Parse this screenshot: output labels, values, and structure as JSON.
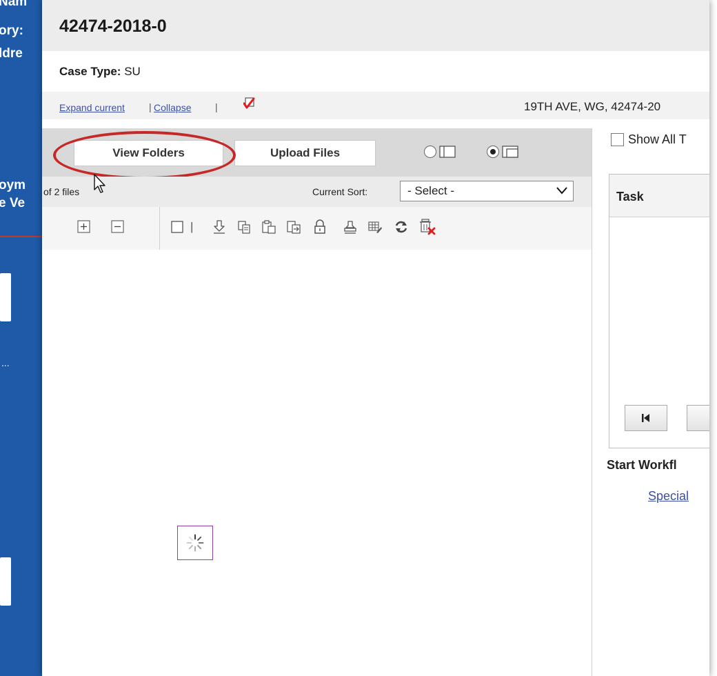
{
  "background": {
    "fragments": [
      "Nam",
      "ory:",
      "ldre",
      "oym",
      "e Ve",
      "..."
    ]
  },
  "modal": {
    "title": "42474-2018-0",
    "case_type_label": "Case Type:",
    "case_type_value": "SU",
    "expand_current": "Expand current",
    "collapse": "Collapse",
    "link_separator": "|",
    "address": "19TH AVE, WG, 42474-20"
  },
  "documents": {
    "view_folders": "View Folders",
    "upload_files": "Upload Files",
    "files_count": "of 2 files",
    "current_sort_label": "Current Sort:",
    "current_sort_value": "- Select -",
    "toolbar_separator": "|",
    "view_mode_selected": 2
  },
  "right": {
    "show_all": "Show All T",
    "task_header": "Task",
    "start_workflow": "Start Workfl",
    "special_link": "Special"
  },
  "colors": {
    "accent_blue": "#1e5aa8",
    "highlight_red": "#c62828",
    "link_color": "#3b4fa5",
    "spinner_border": "#8e3fa3"
  }
}
